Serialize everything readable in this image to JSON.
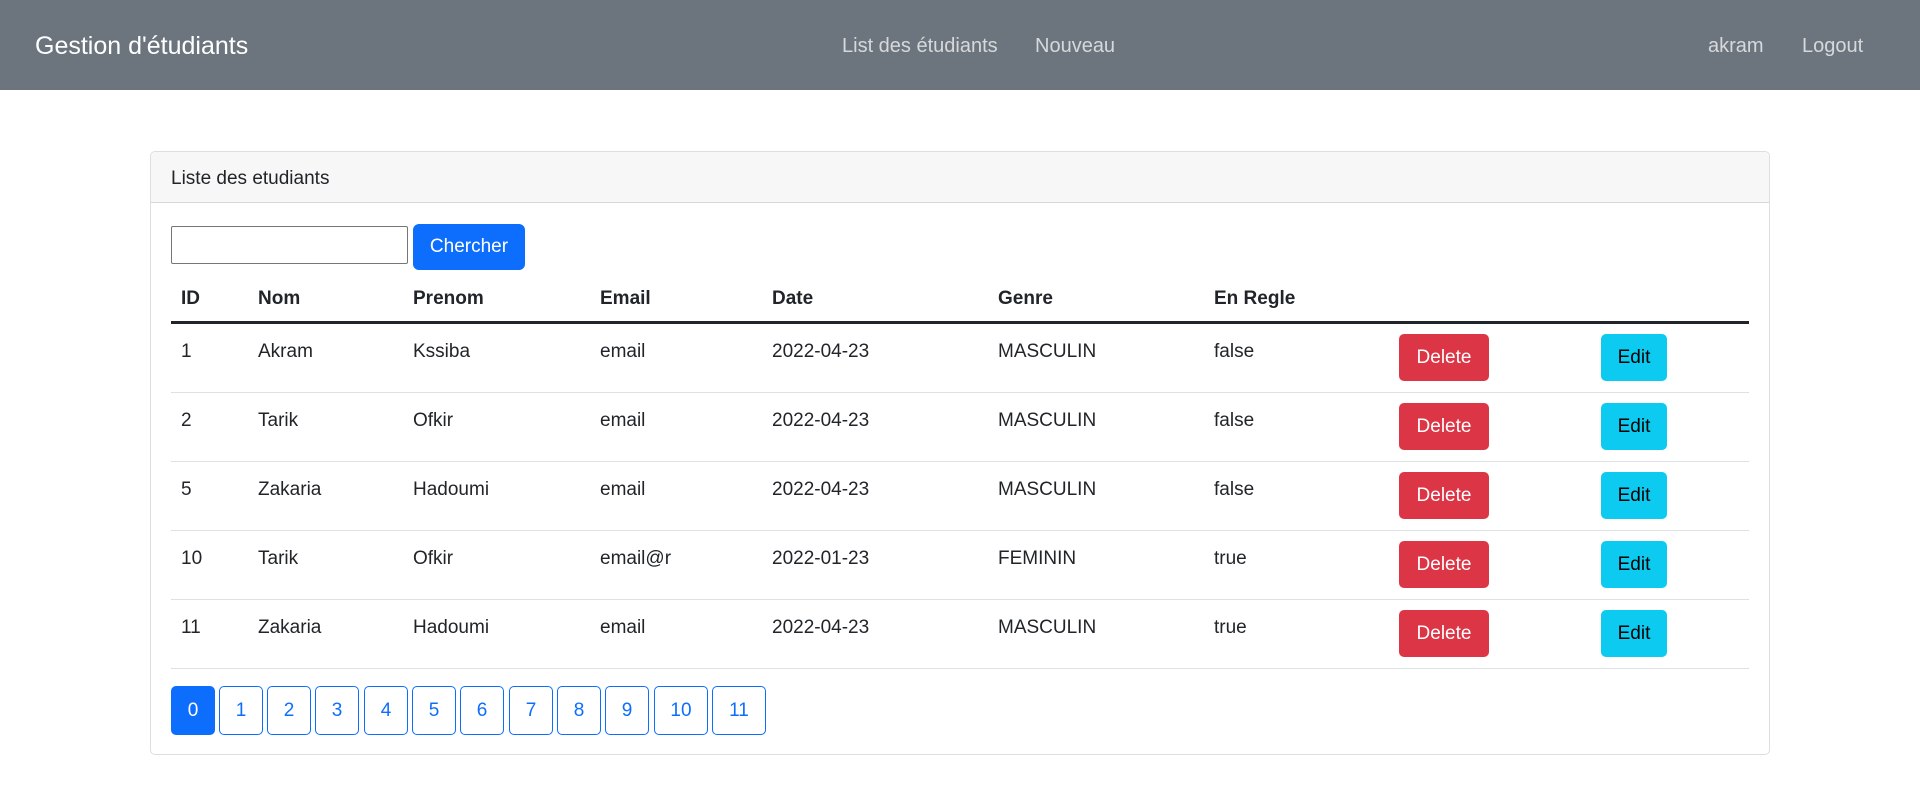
{
  "navbar": {
    "brand": "Gestion d'étudiants",
    "links": [
      "List des étudiants",
      "Nouveau"
    ],
    "user": "akram",
    "logout": "Logout",
    "bg_color": "#6c757d"
  },
  "card": {
    "title": "Liste des etudiants"
  },
  "search": {
    "value": "",
    "placeholder": "",
    "button_label": "Chercher"
  },
  "table": {
    "headers": [
      "ID",
      "Nom",
      "Prenom",
      "Email",
      "Date",
      "Genre",
      "En Regle"
    ],
    "rows": [
      {
        "id": "1",
        "nom": "Akram",
        "prenom": "Kssiba",
        "email": "email",
        "date": "2022-04-23",
        "genre": "MASCULIN",
        "en_regle": "false",
        "delete_label": "Delete",
        "edit_label": "Edit"
      },
      {
        "id": "2",
        "nom": "Tarik",
        "prenom": "Ofkir",
        "email": "email",
        "date": "2022-04-23",
        "genre": "MASCULIN",
        "en_regle": "false",
        "delete_label": "Delete",
        "edit_label": "Edit"
      },
      {
        "id": "5",
        "nom": "Zakaria",
        "prenom": "Hadoumi",
        "email": "email",
        "date": "2022-04-23",
        "genre": "MASCULIN",
        "en_regle": "false",
        "delete_label": "Delete",
        "edit_label": "Edit"
      },
      {
        "id": "10",
        "nom": "Tarik",
        "prenom": "Ofkir",
        "email": "email@r",
        "date": "2022-01-23",
        "genre": "FEMININ",
        "en_regle": "true",
        "delete_label": "Delete",
        "edit_label": "Edit"
      },
      {
        "id": "11",
        "nom": "Zakaria",
        "prenom": "Hadoumi",
        "email": "email",
        "date": "2022-04-23",
        "genre": "MASCULIN",
        "en_regle": "true",
        "delete_label": "Delete",
        "edit_label": "Edit"
      }
    ]
  },
  "pagination": {
    "pages": [
      "0",
      "1",
      "2",
      "3",
      "4",
      "5",
      "6",
      "7",
      "8",
      "9",
      "10",
      "11"
    ],
    "active_page": "0"
  },
  "colors": {
    "primary": "#0d6efd",
    "danger": "#dc3545",
    "info": "#0dcaf0"
  }
}
